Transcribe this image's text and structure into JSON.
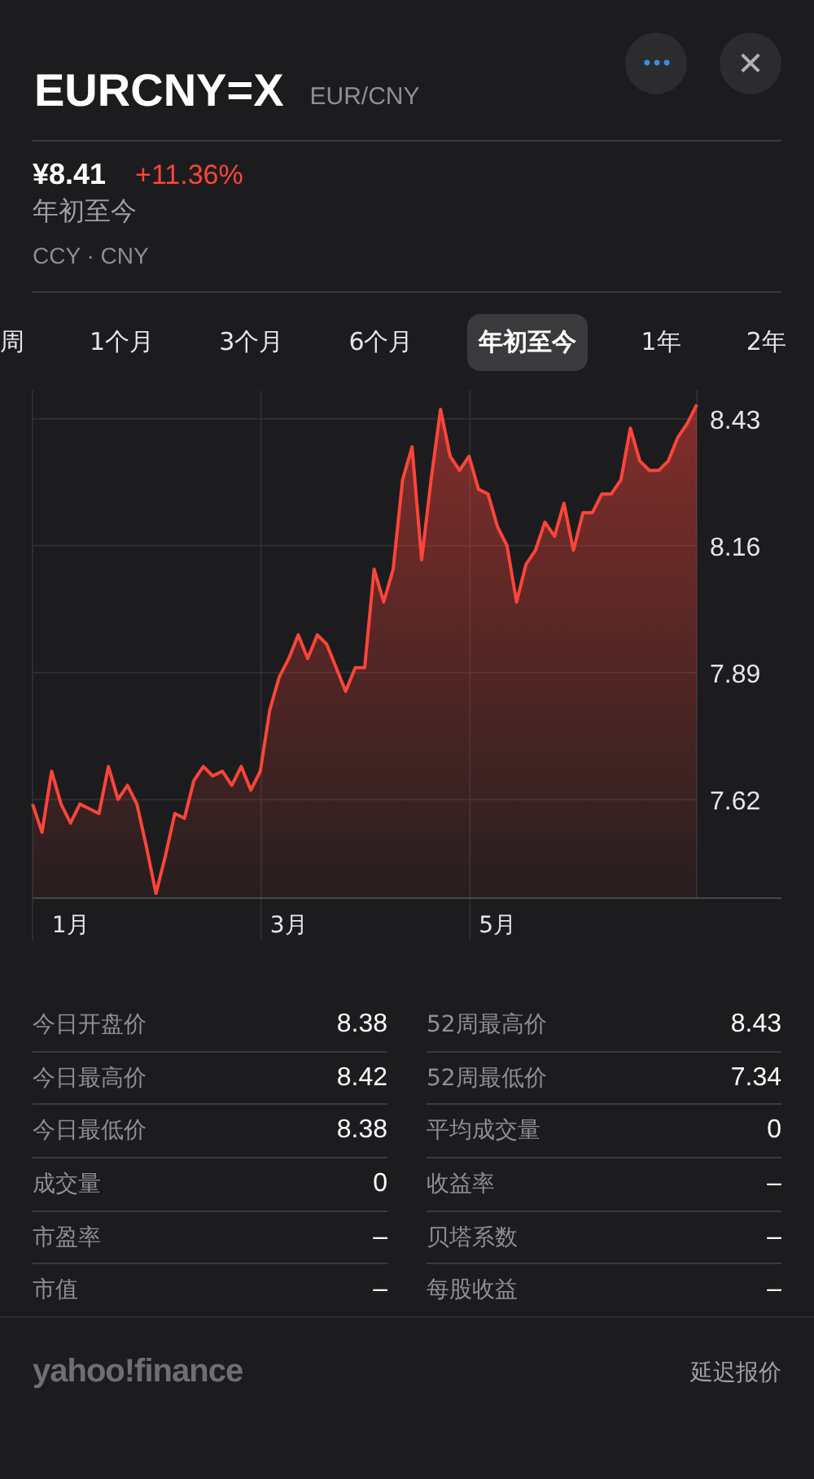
{
  "header": {
    "symbol": "EURCNY=X",
    "pair": "EUR/CNY",
    "more_icon": "•••",
    "close_icon": "✕"
  },
  "quote": {
    "price": "¥8.41",
    "change": "+11.36%",
    "period": "年初至今",
    "exchange": "CCY · CNY"
  },
  "tabs": [
    {
      "label": "周",
      "selected": false
    },
    {
      "label": "1个月",
      "selected": false
    },
    {
      "label": "3个月",
      "selected": false
    },
    {
      "label": "6个月",
      "selected": false
    },
    {
      "label": "年初至今",
      "selected": true
    },
    {
      "label": "1年",
      "selected": false
    },
    {
      "label": "2年",
      "selected": false
    }
  ],
  "chart_data": {
    "type": "area",
    "grid": true,
    "ylim": [
      7.41,
      8.49
    ],
    "yticks": [
      7.62,
      7.89,
      8.16,
      8.43
    ],
    "categories": [
      null,
      null,
      null,
      null,
      "1月",
      null,
      null,
      null,
      null,
      null,
      null,
      null,
      null,
      null,
      null,
      null,
      null,
      null,
      null,
      null,
      null,
      null,
      null,
      null,
      null,
      null,
      null,
      "3月",
      null,
      null,
      null,
      null,
      null,
      null,
      null,
      null,
      null,
      null,
      null,
      null,
      null,
      null,
      null,
      null,
      null,
      null,
      null,
      null,
      null,
      "5月",
      null,
      null,
      null,
      null,
      null,
      null,
      null,
      null,
      null,
      null,
      null,
      null,
      null,
      null,
      null,
      null,
      null,
      null,
      null,
      null,
      null
    ],
    "series": [
      {
        "color": "#ff453a",
        "values": [
          7.61,
          7.55,
          7.68,
          7.61,
          7.57,
          7.61,
          7.6,
          7.59,
          7.69,
          7.62,
          7.65,
          7.61,
          7.52,
          7.42,
          7.5,
          7.59,
          7.58,
          7.66,
          7.69,
          7.67,
          7.68,
          7.65,
          7.69,
          7.64,
          7.68,
          7.81,
          7.88,
          7.92,
          7.97,
          7.92,
          7.97,
          7.95,
          7.9,
          7.85,
          7.9,
          7.9,
          8.11,
          8.04,
          8.11,
          8.3,
          8.37,
          8.13,
          8.3,
          8.45,
          8.35,
          8.32,
          8.35,
          8.28,
          8.27,
          8.2,
          8.16,
          8.04,
          8.12,
          8.15,
          8.21,
          8.18,
          8.25,
          8.15,
          8.23,
          8.23,
          8.27,
          8.27,
          8.3,
          8.41,
          8.34,
          8.32,
          8.32,
          8.34,
          8.39,
          8.42,
          8.46
        ]
      }
    ]
  },
  "stats": {
    "left": [
      {
        "label": "今日开盘价",
        "value": "8.38"
      },
      {
        "label": "今日最高价",
        "value": "8.42"
      },
      {
        "label": "今日最低价",
        "value": "8.38"
      },
      {
        "label": "成交量",
        "value": "0"
      },
      {
        "label": "市盈率",
        "value": "–"
      },
      {
        "label": "市值",
        "value": "–"
      }
    ],
    "right": [
      {
        "label": "52周最高价",
        "value": "8.43"
      },
      {
        "label": "52周最低价",
        "value": "7.34"
      },
      {
        "label": "平均成交量",
        "value": "0"
      },
      {
        "label": "收益率",
        "value": "–"
      },
      {
        "label": "贝塔系数",
        "value": "–"
      },
      {
        "label": "每股收益",
        "value": "–"
      }
    ]
  },
  "footer": {
    "logo": "yahoo!finance",
    "note": "延迟报价"
  }
}
